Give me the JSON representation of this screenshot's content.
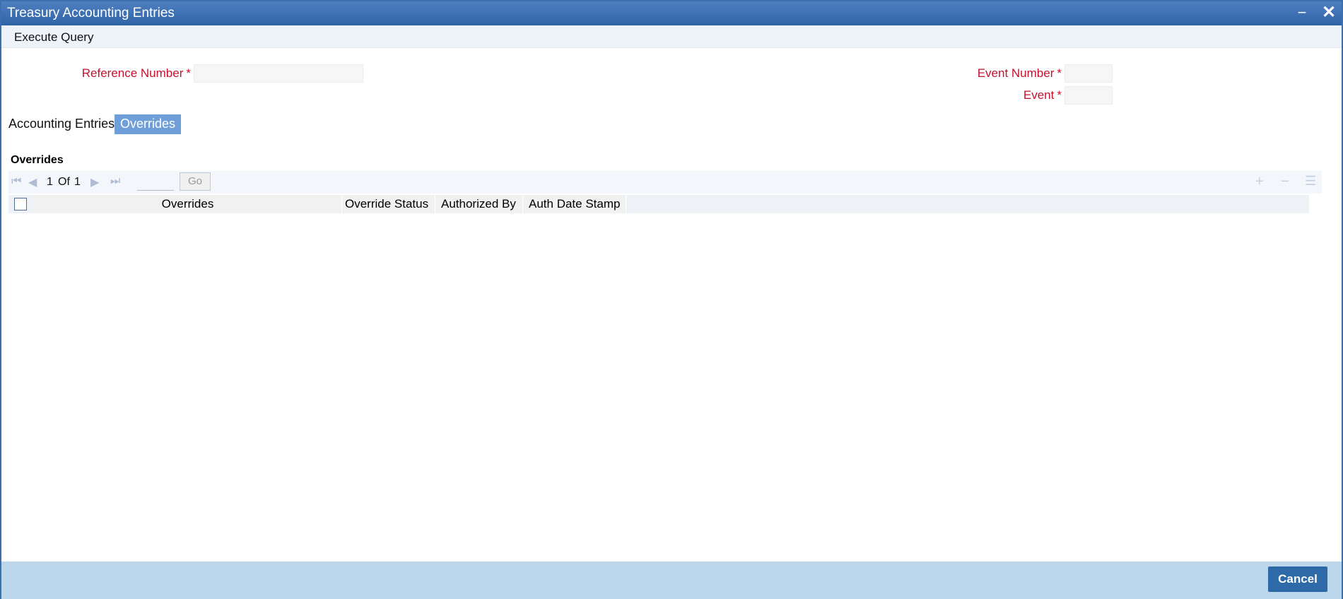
{
  "window": {
    "title": "Treasury Accounting Entries"
  },
  "menu": {
    "execute_query": "Execute Query"
  },
  "form": {
    "reference_number_label": "Reference Number",
    "event_number_label": "Event Number",
    "event_label": "Event",
    "required_marker": "*",
    "reference_number_value": "",
    "event_number_value": "",
    "event_value": ""
  },
  "tabs": [
    {
      "label": "Accounting Entries",
      "active": false
    },
    {
      "label": "Overrides",
      "active": true
    }
  ],
  "overrides": {
    "section_title": "Overrides",
    "pager": {
      "current": "1",
      "of_label": "Of",
      "total": "1",
      "go_label": "Go",
      "page_input": ""
    },
    "columns": [
      "Overrides",
      "Override Status",
      "Authorized By",
      "Auth Date Stamp"
    ],
    "rows": []
  },
  "footer": {
    "cancel_label": "Cancel"
  },
  "colors": {
    "title_bar": "#3a6fb0",
    "required_label": "#c8102e",
    "active_tab": "#6f9fd8",
    "footer": "#bcd6ec",
    "cancel_button": "#2f6aa8"
  },
  "icons": {
    "first_page": "first-page-icon",
    "prev_page": "prev-page-icon",
    "next_page": "next-page-icon",
    "last_page": "last-page-icon",
    "add_row": "plus-icon",
    "delete_row": "minus-icon",
    "row_details": "list-icon",
    "minimize": "minimize-icon",
    "close": "close-icon"
  }
}
